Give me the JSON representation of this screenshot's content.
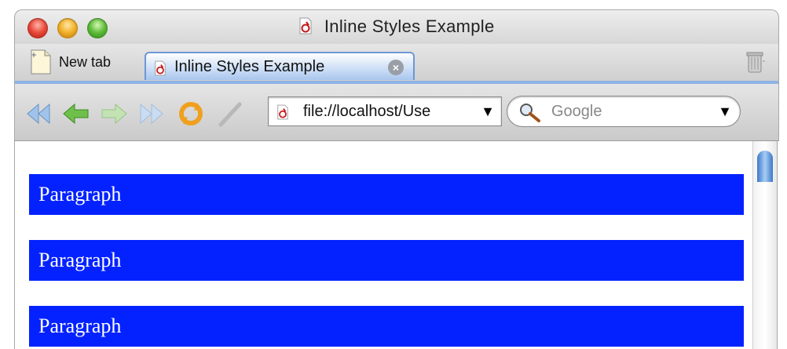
{
  "window": {
    "title": "Inline Styles Example"
  },
  "tabs": {
    "new_tab_label": "New tab",
    "active_tab_label": "Inline Styles Example"
  },
  "toolbar": {
    "url": "file://localhost/Use",
    "search_placeholder": "Google",
    "icons": [
      "back-to-start-icon",
      "back-icon",
      "forward-icon",
      "forward-to-end-icon",
      "reload-icon",
      "stop-icon"
    ]
  },
  "content": {
    "paragraphs": [
      "Paragraph",
      "Paragraph",
      "Paragraph"
    ]
  },
  "colors": {
    "paragraph_background": "#0422ff",
    "paragraph_text": "#ffffff",
    "tab_accent": "#6c97d6"
  }
}
